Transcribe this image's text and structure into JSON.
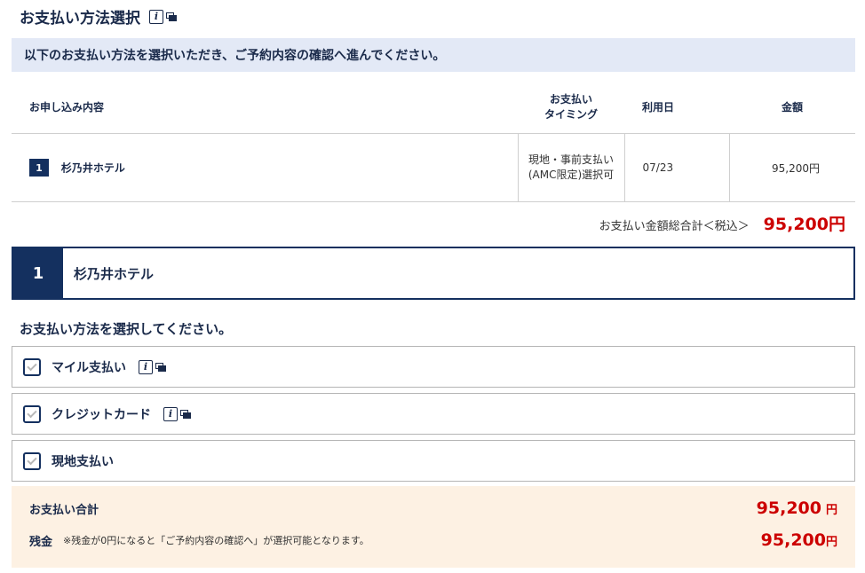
{
  "page": {
    "title": "お支払い方法選択"
  },
  "notice": "以下のお支払い方法を選択いただき、ご予約内容の確認へ進んでください。",
  "summary": {
    "headers": {
      "content": "お申し込み内容",
      "timing_line1": "お支払い",
      "timing_line2": "タイミング",
      "date": "利用日",
      "amount": "金額"
    },
    "rows": [
      {
        "number": "1",
        "name": "杉乃井ホテル",
        "timing": "現地・事前支払い(AMC限定)選択可",
        "date": "07/23",
        "amount": "95,200円"
      }
    ],
    "total_label": "お支払い金額総合計＜税込＞",
    "total_amount": "95,200円"
  },
  "hotel_section": {
    "number": "1",
    "name": "杉乃井ホテル"
  },
  "select_prompt": "お支払い方法を選択してください。",
  "methods": [
    {
      "label": "マイル支払い",
      "has_info": true,
      "checked": false
    },
    {
      "label": "クレジットカード",
      "has_info": true,
      "checked": false
    },
    {
      "label": "現地支払い",
      "has_info": false,
      "checked": false
    }
  ],
  "payment_total": {
    "label": "お支払い合計",
    "amount": "95,200",
    "unit": "円",
    "balance_label": "残金",
    "balance_note": "※残金が0円になると「ご予約内容の確認へ」が選択可能となります。",
    "balance_amount": "95,200",
    "balance_unit": "円"
  },
  "colors": {
    "navy": "#14305f",
    "price_red": "#cc0000",
    "notice_bg": "#e3e9f6",
    "total_bg": "#fdf1e3"
  },
  "icons": {
    "info": "info-popup-icon"
  }
}
